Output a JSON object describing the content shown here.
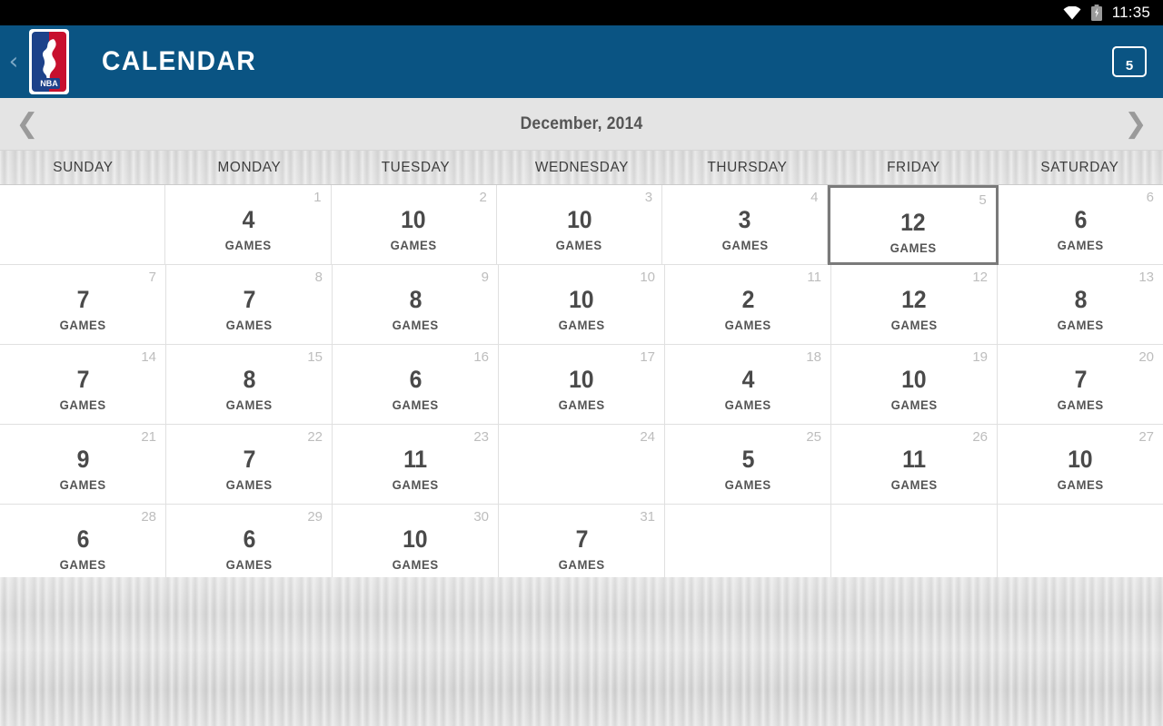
{
  "statusbar": {
    "time": "11:35",
    "wifi_icon": "wifi-icon",
    "battery_icon": "battery-charging-icon"
  },
  "appbar": {
    "back_icon": "back-chevron-icon",
    "logo": "nba-logo",
    "logo_text": "NBA",
    "title": "CALENDAR",
    "action_icon": "calendar-day-icon",
    "action_value": "5",
    "background_color": "#0a5483"
  },
  "month_nav": {
    "prev_icon": "chevron-left-icon",
    "next_icon": "chevron-right-icon",
    "title": "December, 2014"
  },
  "calendar": {
    "day_headers": [
      "SUNDAY",
      "MONDAY",
      "TUESDAY",
      "WEDNESDAY",
      "THURSDAY",
      "FRIDAY",
      "SATURDAY"
    ],
    "games_label": "GAMES",
    "selected_day": "5",
    "selection_color": "#7a7a7a",
    "weeks": [
      [
        {
          "day": "",
          "games": ""
        },
        {
          "day": "1",
          "games": "4"
        },
        {
          "day": "2",
          "games": "10"
        },
        {
          "day": "3",
          "games": "10"
        },
        {
          "day": "4",
          "games": "3"
        },
        {
          "day": "5",
          "games": "12",
          "selected": true
        },
        {
          "day": "6",
          "games": "6"
        }
      ],
      [
        {
          "day": "7",
          "games": "7"
        },
        {
          "day": "8",
          "games": "7"
        },
        {
          "day": "9",
          "games": "8"
        },
        {
          "day": "10",
          "games": "10"
        },
        {
          "day": "11",
          "games": "2"
        },
        {
          "day": "12",
          "games": "12"
        },
        {
          "day": "13",
          "games": "8"
        }
      ],
      [
        {
          "day": "14",
          "games": "7"
        },
        {
          "day": "15",
          "games": "8"
        },
        {
          "day": "16",
          "games": "6"
        },
        {
          "day": "17",
          "games": "10"
        },
        {
          "day": "18",
          "games": "4"
        },
        {
          "day": "19",
          "games": "10"
        },
        {
          "day": "20",
          "games": "7"
        }
      ],
      [
        {
          "day": "21",
          "games": "9"
        },
        {
          "day": "22",
          "games": "7"
        },
        {
          "day": "23",
          "games": "11"
        },
        {
          "day": "24",
          "games": ""
        },
        {
          "day": "25",
          "games": "5"
        },
        {
          "day": "26",
          "games": "11"
        },
        {
          "day": "27",
          "games": "10"
        }
      ],
      [
        {
          "day": "28",
          "games": "6"
        },
        {
          "day": "29",
          "games": "6"
        },
        {
          "day": "30",
          "games": "10"
        },
        {
          "day": "31",
          "games": "7"
        },
        {
          "day": "",
          "games": ""
        },
        {
          "day": "",
          "games": ""
        },
        {
          "day": "",
          "games": ""
        }
      ]
    ]
  }
}
